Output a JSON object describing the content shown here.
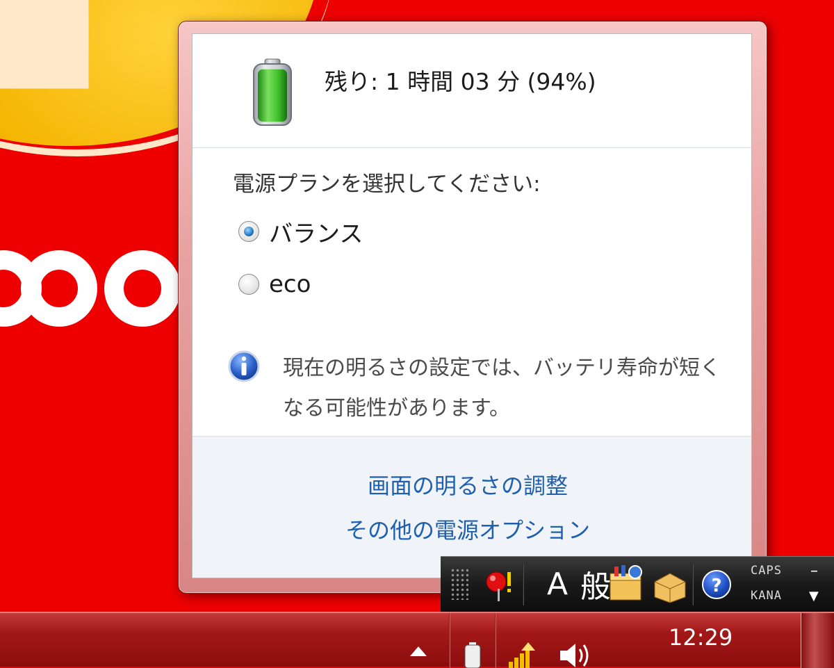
{
  "flyout": {
    "battery_status": "残り: 1 時間 03 分 (94%)",
    "battery_level_percent": 94,
    "plan_heading": "電源プランを選択してください:",
    "plans": [
      {
        "label": "バランス",
        "selected": true
      },
      {
        "label": "eco",
        "selected": false
      }
    ],
    "info_message": "現在の明るさの設定では、バッテリ寿命が短くなる可能性があります。",
    "links": {
      "brightness": "画面の明るさの調整",
      "more_options": "その他の電源オプション"
    }
  },
  "language_bar": {
    "input_mode": "A",
    "dictionary_mode": "般",
    "caps": "CAPS",
    "kana": "KANA",
    "minimize_glyph": "–",
    "options_glyph": "▼",
    "help_glyph": "?"
  },
  "taskbar": {
    "clock_time": "12:29"
  },
  "colors": {
    "link": "#1e5fae",
    "flyout_border": "#e8a2a2",
    "desktop": "#ee0000",
    "taskbar": "#a31818",
    "battery_fill": "#3fbf2a"
  }
}
